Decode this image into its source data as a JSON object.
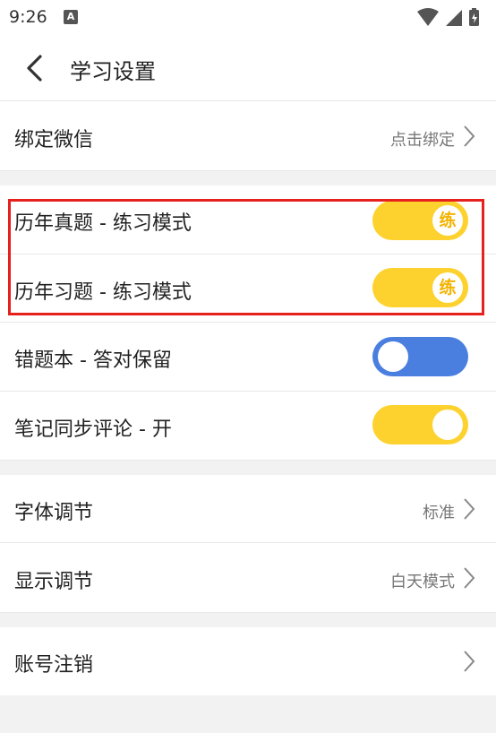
{
  "status": {
    "time": "9:26",
    "app_icon_letter": "A"
  },
  "header": {
    "back_icon": "chevron-left-icon",
    "title": "学习设置"
  },
  "rows": {
    "bind_wechat": {
      "label": "绑定微信",
      "value": "点击绑定"
    },
    "past_exam_mode": {
      "label": "历年真题 - 练习模式",
      "toggle_on": true,
      "knob_text": "练"
    },
    "past_practice_mode": {
      "label": "历年习题 - 练习模式",
      "toggle_on": true,
      "knob_text": "练"
    },
    "wrong_book_keep": {
      "label": "错题本 - 答对保留",
      "toggle_on": false
    },
    "notes_sync": {
      "label": "笔记同步评论 - 开",
      "toggle_on": true
    },
    "font_adjust": {
      "label": "字体调节",
      "value": "标准"
    },
    "display_adjust": {
      "label": "显示调节",
      "value": "白天模式"
    },
    "account_cancel": {
      "label": "账号注销"
    }
  },
  "colors": {
    "toggle_on": "#fdd22e",
    "toggle_off": "#4a7fe0",
    "highlight": "#e6201d",
    "knob_text": "#f4b300"
  }
}
